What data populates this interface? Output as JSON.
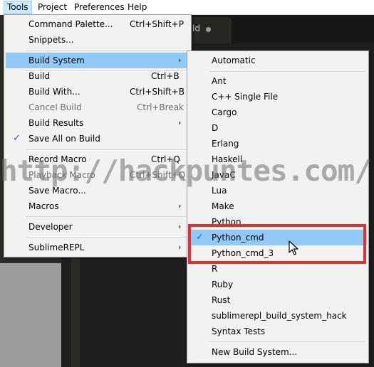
{
  "menubar": {
    "items": [
      "Tools",
      "Project",
      "Preferences",
      "Help"
    ],
    "tab_label": "ld"
  },
  "tools_menu": {
    "items": [
      {
        "label": "Command Palette...",
        "shortcut": "Ctrl+Shift+P"
      },
      {
        "label": "Snippets...",
        "shortcut": ""
      },
      {
        "label": "Build System",
        "shortcut": "",
        "submenu": true,
        "highlighted": true
      },
      {
        "label": "Build",
        "shortcut": "Ctrl+B"
      },
      {
        "label": "Build With...",
        "shortcut": "Ctrl+Shift+B"
      },
      {
        "label": "Cancel Build",
        "shortcut": "Ctrl+Break",
        "disabled": true
      },
      {
        "label": "Build Results",
        "shortcut": "",
        "submenu": true
      },
      {
        "label": "Save All on Build",
        "shortcut": "",
        "checked": true
      },
      {
        "label": "Record Macro",
        "shortcut": "Ctrl+Q"
      },
      {
        "label": "Playback Macro",
        "shortcut": "Ctrl+Shift+Q",
        "disabled": true
      },
      {
        "label": "Save Macro...",
        "shortcut": ""
      },
      {
        "label": "Macros",
        "shortcut": "",
        "submenu": true
      },
      {
        "label": "Developer",
        "shortcut": "",
        "submenu": true
      },
      {
        "label": "SublimeREPL",
        "shortcut": "",
        "submenu": true
      }
    ]
  },
  "build_system_menu": {
    "items": [
      {
        "label": "Automatic"
      },
      {
        "label": "Ant"
      },
      {
        "label": "C++ Single File"
      },
      {
        "label": "Cargo"
      },
      {
        "label": "D"
      },
      {
        "label": "Erlang"
      },
      {
        "label": "Haskell"
      },
      {
        "label": "JavaC"
      },
      {
        "label": "Lua"
      },
      {
        "label": "Make"
      },
      {
        "label": "Python"
      },
      {
        "label": "Python_cmd",
        "checked": true,
        "highlighted": true
      },
      {
        "label": "Python_cmd_3"
      },
      {
        "label": "R"
      },
      {
        "label": "Ruby"
      },
      {
        "label": "Rust"
      },
      {
        "label": "sublimerepl_build_system_hack"
      },
      {
        "label": "Syntax Tests"
      },
      {
        "label": "New Build System..."
      }
    ]
  },
  "watermark": "http://hackpuntes.com/",
  "icons": {
    "check": "check-icon",
    "submenu_arrow": "chevron-right-icon",
    "cursor": "mouse-pointer-icon"
  },
  "colors": {
    "highlight": "#91c9f7",
    "callout_border": "#e03131",
    "menu_bg": "#f2f2f2"
  }
}
